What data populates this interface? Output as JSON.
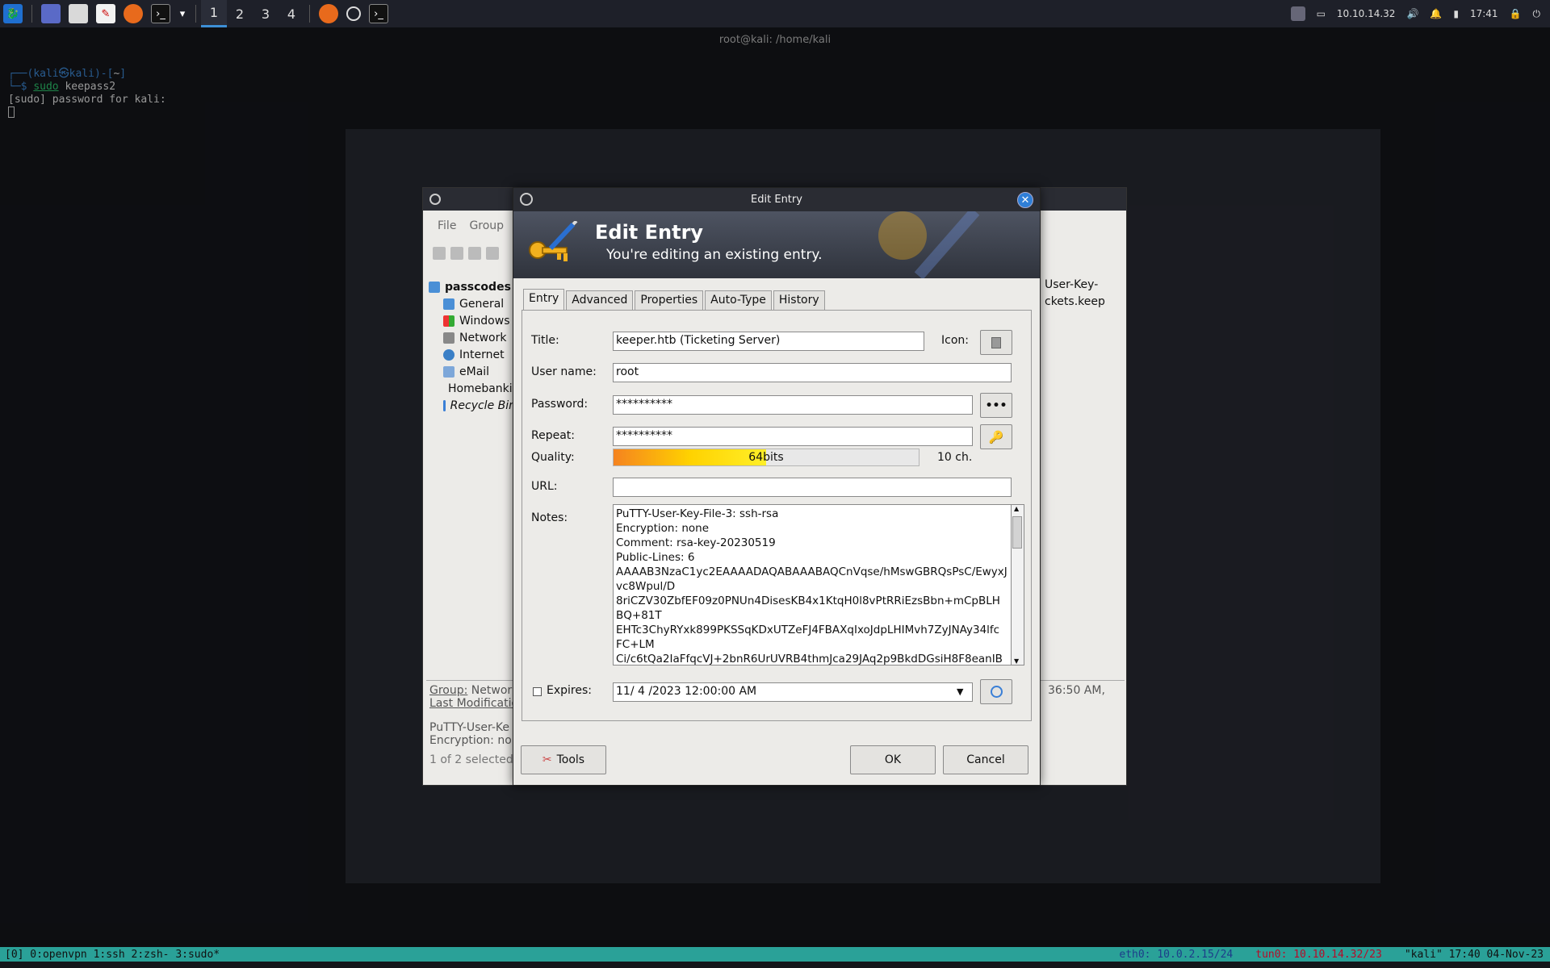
{
  "taskbar": {
    "workspaces": [
      "1",
      "2",
      "3",
      "4"
    ],
    "tray": {
      "ip": "10.10.14.32",
      "time": "17:41"
    }
  },
  "terminal": {
    "window_title": "root@kali: /home/kali",
    "prompt_user": "kali",
    "prompt_host": "kali",
    "prompt_dir": "~",
    "command_sudo": "sudo",
    "command_rest": "keepass2",
    "output": "[sudo] password for kali:"
  },
  "keepass_main": {
    "menu": [
      "File",
      "Group"
    ],
    "tree": {
      "root": "passcodes",
      "groups": [
        "General",
        "Windows",
        "Network",
        "Internet",
        "eMail",
        "Homebanking",
        "Recycle Bin"
      ]
    },
    "right_snippets": [
      "User-Key-",
      "ckets.keep"
    ],
    "status": {
      "group_label": "Group:",
      "group_value": "Network",
      "last_mod_label": "Last Modificatio",
      "time_fragment": "36:50 AM,",
      "notes_preview_1": "PuTTY-User-Ke",
      "notes_preview_2": "Encryption: none",
      "selection": "1 of 2 selected"
    }
  },
  "dialog": {
    "window_title": "Edit Entry",
    "banner_title": "Edit Entry",
    "banner_subtitle": "You're editing an existing entry.",
    "tabs": [
      "Entry",
      "Advanced",
      "Properties",
      "Auto-Type",
      "History"
    ],
    "labels": {
      "title": "Title:",
      "icon": "Icon:",
      "username": "User name:",
      "password": "Password:",
      "repeat": "Repeat:",
      "quality": "Quality:",
      "url": "URL:",
      "notes": "Notes:",
      "expires": "Expires:"
    },
    "fields": {
      "title": "keeper.htb (Ticketing Server)",
      "username": "root",
      "password": "**********",
      "repeat": "**********",
      "url": "",
      "expires": "11/ 4 /2023 12:00:00 AM"
    },
    "quality": {
      "value_text": "64",
      "unit": " bits",
      "fill_fraction": 0.5,
      "length": "10 ch."
    },
    "show_password_button": "•••",
    "notes": "PuTTY-User-Key-File-3: ssh-rsa\nEncryption: none\nComment: rsa-key-20230519\nPublic-Lines: 6\nAAAAB3NzaC1yc2EAAAADAQABAAABAQCnVqse/hMswGBRQsPsC/EwyxJ\nvc8Wpul/D\n8riCZV30ZbfEF09z0PNUn4DisesKB4x1KtqH0l8vPtRRiEzsBbn+mCpBLH\nBQ+81T\nEHTc3ChyRYxk899PKSSqKDxUTZeFJ4FBAXqIxoJdpLHIMvh7ZyJNAy34lfc\nFC+LM\nCi/c6tQa2IaFfqcVJ+2bnR6UrUVRB4thmJca29JAq2p9BkdDGsiH8F8eanIB",
    "buttons": {
      "tools": "Tools",
      "ok": "OK",
      "cancel": "Cancel"
    }
  },
  "tmux": {
    "windows": "[0] 0:openvpn  1:ssh  2:zsh- 3:sudo*",
    "eth0": "eth0: 10.0.2.15/24",
    "tun0": "tun0: 10.10.14.32/23",
    "host_time": "\"kali\" 17:40 04-Nov-23"
  }
}
